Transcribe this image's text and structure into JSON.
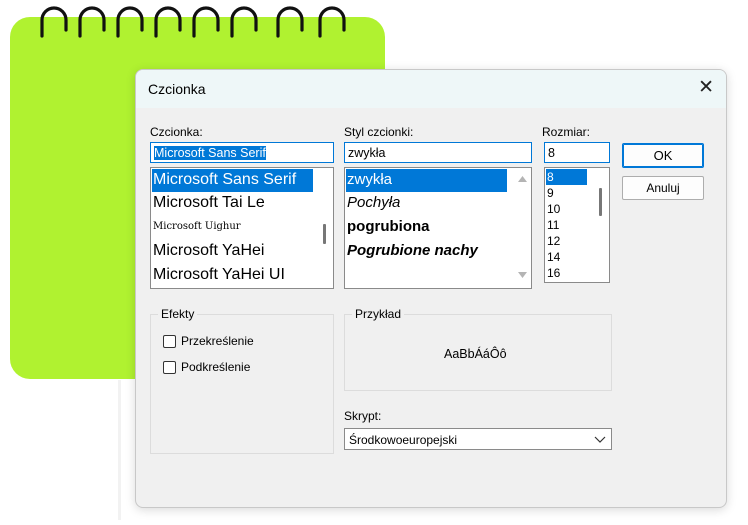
{
  "dialog": {
    "title": "Czcionka",
    "close_glyph": "✕",
    "font": {
      "label": "Czcionka:",
      "value": "Microsoft Sans Serif",
      "items": [
        "Microsoft Sans Serif",
        "Microsoft Tai Le",
        "Microsoft Uighur",
        "Microsoft YaHei",
        "Microsoft YaHei UI"
      ],
      "selected_index": 0
    },
    "style": {
      "label": "Styl czcionki:",
      "value": "zwykła",
      "items": [
        "zwykła",
        "Pochyła",
        "pogrubiona",
        "Pogrubione nachy"
      ],
      "selected_index": 0
    },
    "size": {
      "label": "Rozmiar:",
      "value": "8",
      "items": [
        "8",
        "9",
        "10",
        "11",
        "12",
        "14",
        "16"
      ],
      "selected_index": 0
    },
    "ok_label": "OK",
    "cancel_label": "Anuluj",
    "effects": {
      "label": "Efekty",
      "strikeout_label": "Przekreślenie",
      "underline_label": "Podkreślenie",
      "strikeout_checked": false,
      "underline_checked": false
    },
    "sample": {
      "label": "Przykład",
      "text": "AaBbÁáÔô"
    },
    "script": {
      "label": "Skrypt:",
      "value": "Środkowoeuropejski"
    }
  },
  "colors": {
    "notebook": "#b0f230",
    "accent": "#0078d7"
  }
}
